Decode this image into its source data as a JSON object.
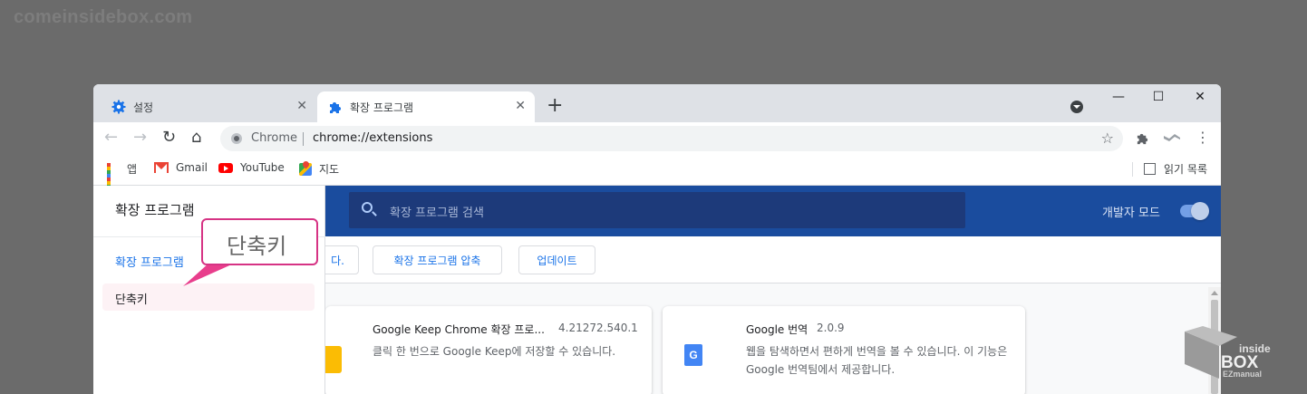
{
  "watermark": "comeinsidebox.com",
  "tabs": [
    {
      "label": "설정",
      "close": "✕"
    },
    {
      "label": "확장 프로그램",
      "close": "✕"
    }
  ],
  "new_tab": "+",
  "window_controls": {
    "minimize": "—",
    "maximize": "☐",
    "close": "✕"
  },
  "toolbar": {
    "back": "←",
    "forward": "→",
    "reload": "↻",
    "home": "⌂",
    "omnibox_chrome": "Chrome",
    "url": "chrome://extensions",
    "star": "☆",
    "menu": "⋮"
  },
  "bookmarks": [
    {
      "label": "앱",
      "icon": "apps-grid-icon"
    },
    {
      "label": "Gmail",
      "icon": "gmail-icon"
    },
    {
      "label": "YouTube",
      "icon": "youtube-icon"
    },
    {
      "label": "지도",
      "icon": "maps-icon"
    }
  ],
  "reading_list": "읽기 목록",
  "sidebar": {
    "title": "확장 프로그램",
    "items": [
      "확장 프로그램",
      "단축키"
    ]
  },
  "header": {
    "search_placeholder": "확장 프로그램 검색",
    "dev_mode_label": "개발자 모드"
  },
  "action_bar": {
    "buttons": [
      "다.",
      "확장 프로그램 압축",
      "업데이트"
    ]
  },
  "extensions": [
    {
      "name": "Google Keep Chrome 확장 프로...",
      "version": "4.21272.540.1",
      "description": "클릭 한 번으로 Google Keep에 저장할 수 있습니다."
    },
    {
      "name": "Google 번역",
      "version": "2.0.9",
      "description": "웹을 탐색하면서 편하게 번역을 볼 수 있습니다. 이 기능은 Google 번역팀에서 제공합니다."
    }
  ],
  "callout": "단축키",
  "logo": {
    "line1": "inside",
    "line2": "BOX",
    "line3": "EZmanual"
  },
  "colors": {
    "accent": "#1a73e8",
    "header_bg": "#1a4c9e",
    "callout_border": "#d63384",
    "tab_strip": "#dee1e6"
  }
}
